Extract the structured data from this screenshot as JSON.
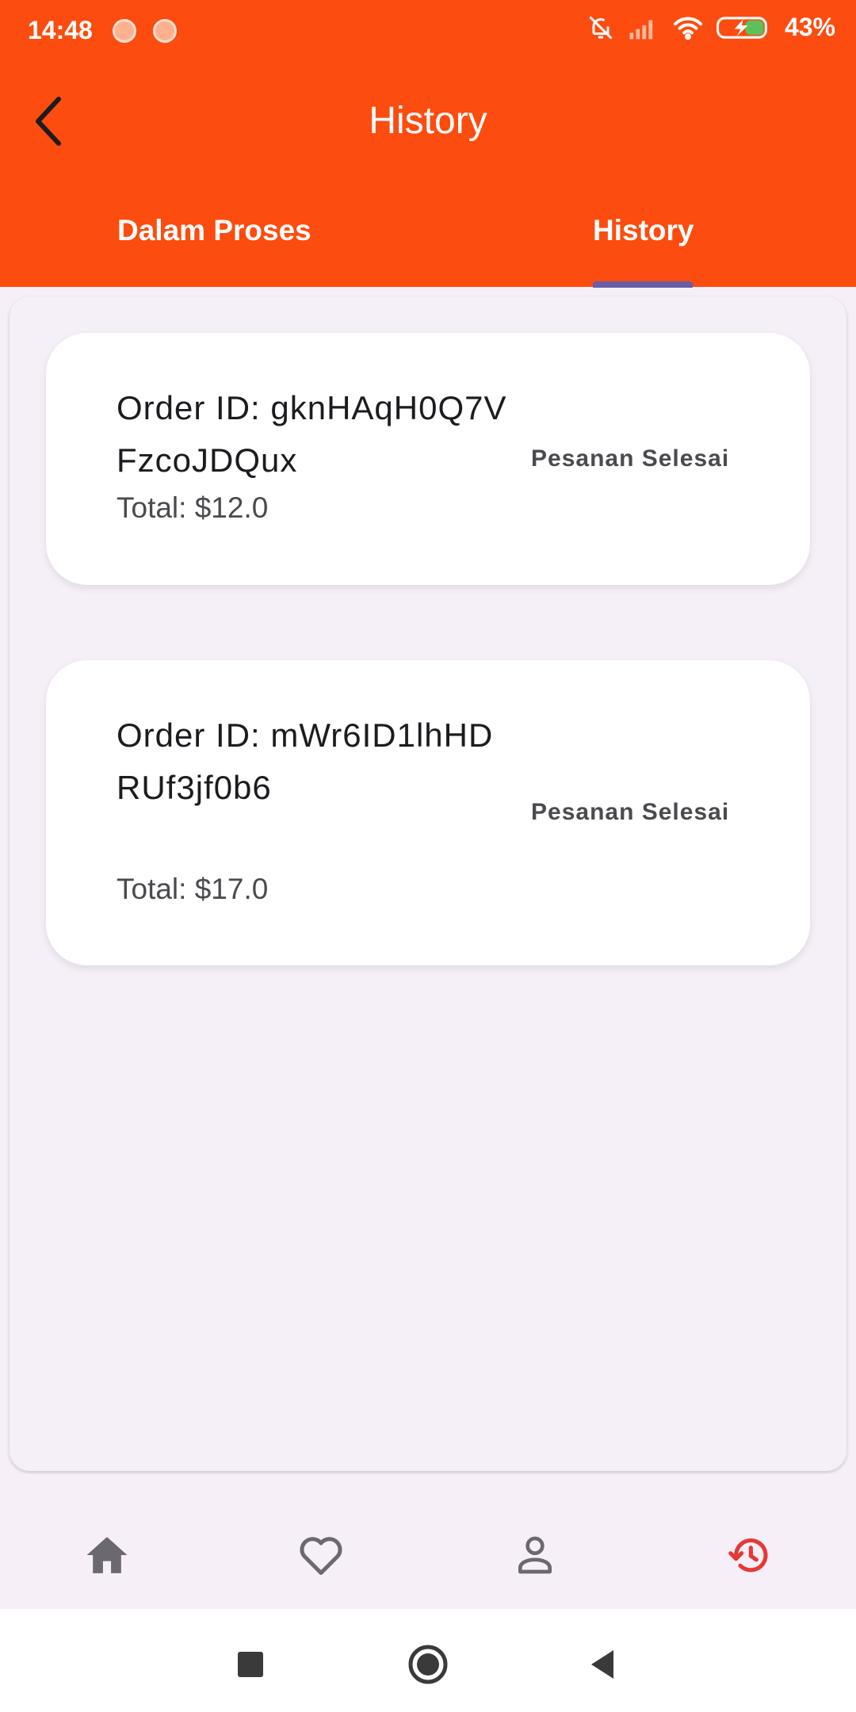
{
  "status_bar": {
    "time": "14:48",
    "battery": "43%",
    "icons": [
      "notification-dot",
      "notification-dot",
      "bell-muted-icon",
      "signal-icon",
      "wifi-icon",
      "battery-charging-icon"
    ]
  },
  "header": {
    "title": "History",
    "back_icon": "arrow-back-icon"
  },
  "tabs": [
    {
      "label": "Dalam Proses",
      "selected": false
    },
    {
      "label": "History",
      "selected": true
    }
  ],
  "orders": [
    {
      "order_id": "Order ID: gknHAqH0Q7VFzcoJDQux",
      "total": "Total: $12.0",
      "status": "Pesanan Selesai"
    },
    {
      "order_id": "Order ID: mWr6ID1lhHDRUf3jf0b6",
      "total": "Total: $17.0",
      "status": "Pesanan Selesai"
    }
  ],
  "bottom_nav": [
    {
      "icon": "home-icon",
      "active": false
    },
    {
      "icon": "heart-icon",
      "active": false
    },
    {
      "icon": "person-icon",
      "active": false
    },
    {
      "icon": "history-icon",
      "active": true
    }
  ],
  "colors": {
    "primary": "#fc4c0f",
    "tab_indicator": "#6a5ea6",
    "nav_active": "#e53935",
    "nav_inactive": "#6b6870",
    "background": "#f7eff8"
  }
}
